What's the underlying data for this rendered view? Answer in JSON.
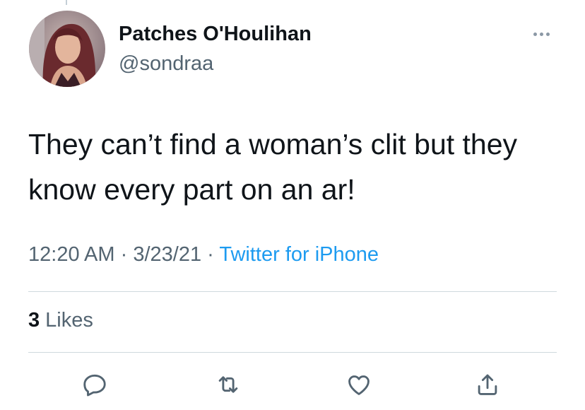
{
  "author": {
    "display_name": "Patches O'Houlihan",
    "handle": "@sondraa"
  },
  "tweet": {
    "text": "They can’t find a woman’s clit but they know every part on an ar!",
    "time": "12:20 AM",
    "separator": "·",
    "date": "3/23/21",
    "source": "Twitter for iPhone"
  },
  "stats": {
    "likes_count": "3",
    "likes_label": "Likes"
  },
  "icons": {
    "more": "more-horizontal-icon",
    "reply": "reply-icon",
    "retweet": "retweet-icon",
    "like": "heart-icon",
    "share": "share-icon"
  },
  "colors": {
    "text_primary": "#0f1419",
    "text_secondary": "#536471",
    "link": "#1d9bf0",
    "divider": "#cfd9de"
  }
}
